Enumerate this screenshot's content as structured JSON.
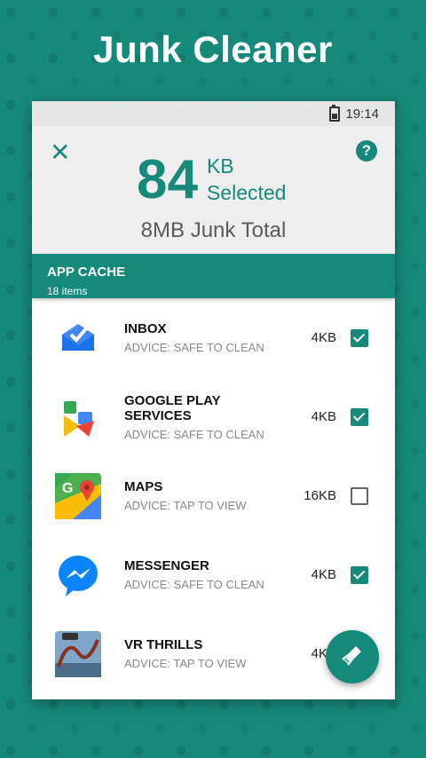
{
  "promo": {
    "title": "Junk Cleaner"
  },
  "status_bar": {
    "time": "19:14"
  },
  "header": {
    "selected_value": "84",
    "selected_unit": "KB",
    "selected_label": "Selected",
    "junk_total": "8MB Junk Total"
  },
  "section": {
    "title": "APP CACHE",
    "count": "18 items"
  },
  "items": [
    {
      "name": "INBOX",
      "advice": "ADVICE: SAFE TO CLEAN",
      "size": "4KB",
      "checked": true,
      "icon": "inbox-icon"
    },
    {
      "name": "GOOGLE PLAY SERVICES",
      "advice": "ADVICE: SAFE TO CLEAN",
      "size": "4KB",
      "checked": true,
      "icon": "google-play-services-icon"
    },
    {
      "name": "MAPS",
      "advice": "ADVICE: TAP TO VIEW",
      "size": "16KB",
      "checked": false,
      "icon": "maps-icon"
    },
    {
      "name": "MESSENGER",
      "advice": "ADVICE: SAFE TO CLEAN",
      "size": "4KB",
      "checked": true,
      "icon": "messenger-icon"
    },
    {
      "name": "VR THRILLS",
      "advice": "ADVICE: TAP TO VIEW",
      "size": "4KB",
      "checked": true,
      "icon": "vr-thrills-icon"
    }
  ],
  "colors": {
    "accent": "#168a7a",
    "background": "#168a7a"
  }
}
